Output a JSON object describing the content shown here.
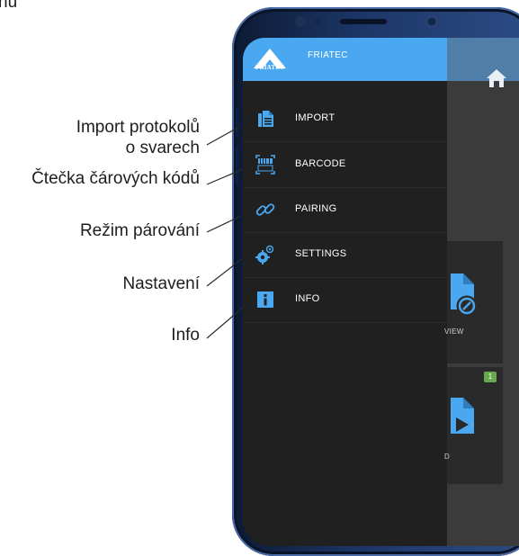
{
  "page": {
    "cropped_caption": "nu"
  },
  "app": {
    "brand": "FRIATEC",
    "logo_text": "FRIATEC",
    "home_icon": "home-icon",
    "colors": {
      "header": "#4aa8f0",
      "app_bar": "#4f7fa8",
      "drawer": "#202020",
      "badge": "#6aa84f"
    }
  },
  "menu": {
    "items": [
      {
        "label": "IMPORT",
        "icon": "document-icon"
      },
      {
        "label": "BARCODE",
        "icon": "barcode-icon"
      },
      {
        "label": "PAIRING",
        "icon": "link-icon"
      },
      {
        "label": "SETTINGS",
        "icon": "gear-icon"
      },
      {
        "label": "INFO",
        "icon": "info-icon"
      }
    ]
  },
  "background": {
    "card1_label": "VIEW",
    "card2_label": "D",
    "badge_count": "1"
  },
  "annotations": {
    "import_line1": "Import protokolů",
    "import_line2": "o svarech",
    "barcode": "Čtečka čárových kódů",
    "pairing": "Režim párování",
    "settings": "Nastavení",
    "info": "Info"
  }
}
